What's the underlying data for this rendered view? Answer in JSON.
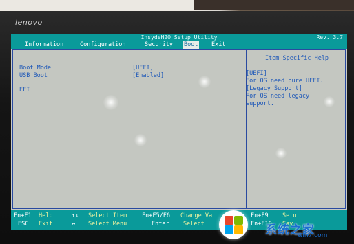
{
  "device": {
    "brand": "lenovo"
  },
  "bios": {
    "title": "InsydeH2O Setup Utility",
    "revision": "Rev. 3.7",
    "menu": [
      "Information",
      "Configuration",
      "Security",
      "Boot",
      "Exit"
    ],
    "active_menu": "Boot",
    "settings": [
      {
        "label": "Boot Mode",
        "value": "[UEFI]"
      },
      {
        "label": "USB Boot",
        "value": "[Enabled]"
      },
      {
        "label": "EFI",
        "value": ""
      }
    ],
    "help": {
      "title": "Item Specific Help",
      "lines": [
        "[UEFI]",
        "For OS need pure UEFI.",
        "[Legacy Support]",
        "For OS need legacy",
        "support."
      ]
    },
    "footer": {
      "row1": [
        {
          "key": "Fn+F1",
          "desc": "Help"
        },
        {
          "key": "↑↓",
          "desc": "Select Item"
        },
        {
          "key": "Fn+F5/F6",
          "desc": "Change Va"
        },
        {
          "key": "Fn+F9",
          "desc": "Setu"
        }
      ],
      "row2": [
        {
          "key": "ESC",
          "desc": "Exit"
        },
        {
          "key": "↔",
          "desc": "Select Menu"
        },
        {
          "key": "Enter",
          "desc": "Select"
        },
        {
          "key": "Fn+F10",
          "desc": "Sav"
        }
      ]
    }
  },
  "watermark": {
    "text": "系统之家",
    "url": "win7.com"
  },
  "colors": {
    "bios_bg": "#c9cbc6",
    "accent": "#0a9a9a",
    "text_blue": "#1e58b8",
    "footer_desc": "#eaf2a0"
  }
}
